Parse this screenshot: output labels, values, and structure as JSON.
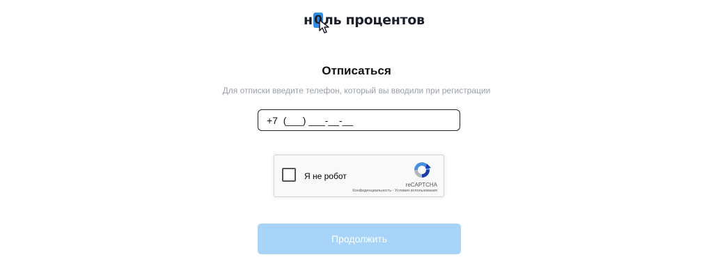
{
  "logo": {
    "prefix": "н",
    "highlight": "0",
    "suffix": "ль процентов",
    "highlight_color": "#2f8de4"
  },
  "title": "Отписаться",
  "subtitle": "Для отписки введите телефон, который вы вводили при регистрации",
  "phone_input": {
    "value": "+7  (___) ___-__-__"
  },
  "recaptcha": {
    "label": "Я не робот",
    "brand": "reCAPTCHA",
    "privacy_link": "Конфиденциальность",
    "separator": " - ",
    "terms_link": "Условия использования",
    "icon": "recaptcha-logo-icon"
  },
  "continue_button": {
    "label": "Продолжить",
    "color": "#a9d4f9"
  }
}
